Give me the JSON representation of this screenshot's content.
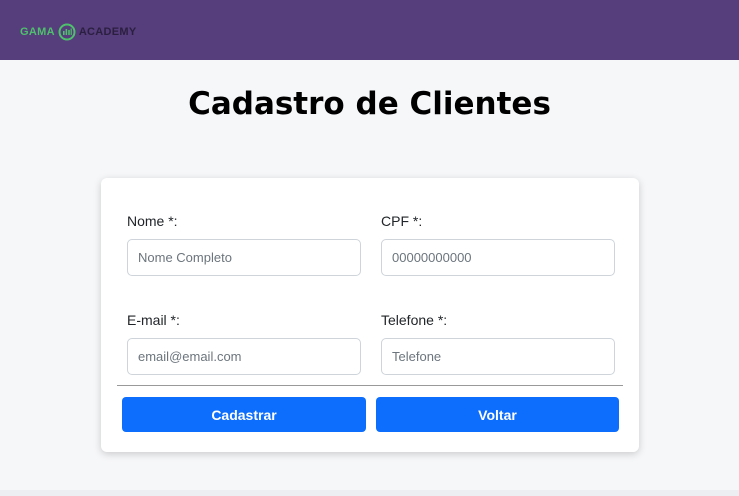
{
  "header": {
    "logo_left": "GAMA",
    "logo_right": "ACADEMY",
    "colors": {
      "bar": "#563d7c",
      "logo_accent": "#4ec16c"
    }
  },
  "page": {
    "title": "Cadastro de Clientes"
  },
  "form": {
    "nome": {
      "label": "Nome *:",
      "placeholder": "Nome Completo",
      "value": ""
    },
    "cpf": {
      "label": "CPF *:",
      "placeholder": "00000000000",
      "value": ""
    },
    "email": {
      "label": "E-mail *:",
      "placeholder": "email@email.com",
      "value": ""
    },
    "telefone": {
      "label": "Telefone *:",
      "placeholder": "Telefone",
      "value": ""
    }
  },
  "actions": {
    "submit_label": "Cadastrar",
    "back_label": "Voltar",
    "button_color": "#0d6efd"
  }
}
